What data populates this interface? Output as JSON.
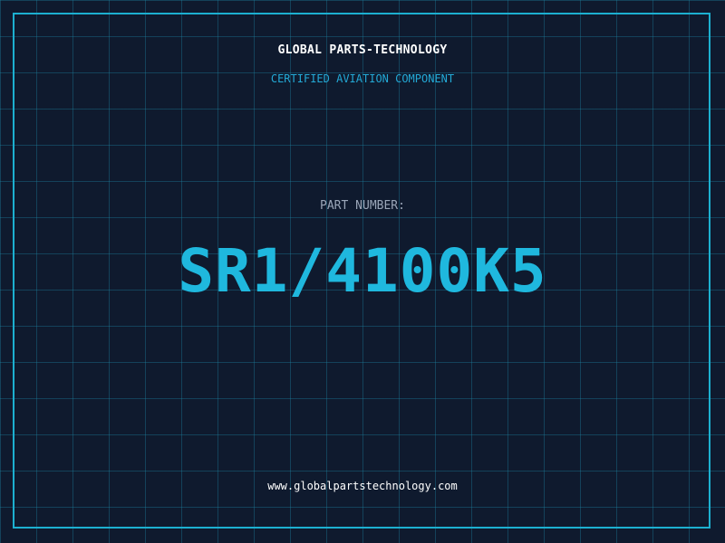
{
  "header": {
    "company": "GLOBAL PARTS-TECHNOLOGY",
    "tagline": "CERTIFIED AVIATION COMPONENT"
  },
  "part": {
    "label": "PART NUMBER:",
    "number": "SR1/4100K5"
  },
  "footer": {
    "website": "www.globalpartstechnology.com"
  },
  "colors": {
    "background": "#0f1a2e",
    "accent": "#1fb8de",
    "frame": "#1cb0d0",
    "label": "#9aa6b8",
    "text": "#ffffff"
  }
}
